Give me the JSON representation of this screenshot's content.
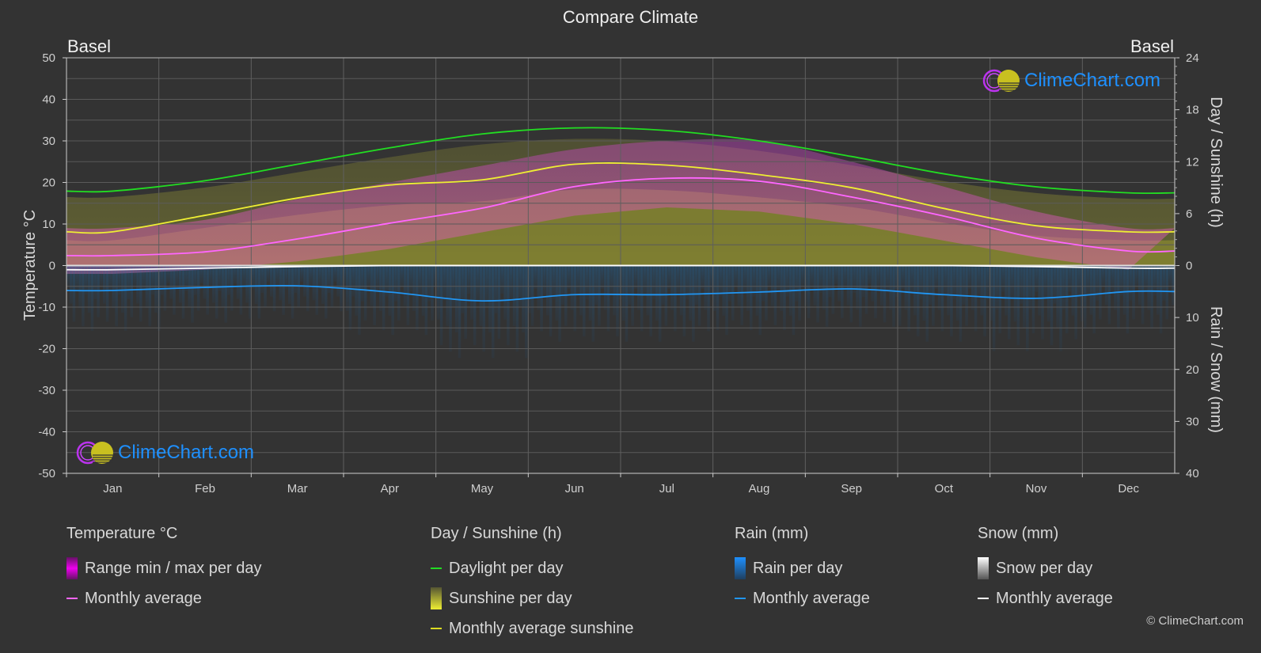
{
  "chart_data": {
    "type": "area",
    "title": "Compare Climate",
    "location_left": "Basel",
    "location_right": "Basel",
    "categories": [
      "Jan",
      "Feb",
      "Mar",
      "Apr",
      "May",
      "Jun",
      "Jul",
      "Aug",
      "Sep",
      "Oct",
      "Nov",
      "Dec"
    ],
    "axes": {
      "left": {
        "label": "Temperature °C",
        "ylim": [
          -50,
          50
        ],
        "ticks": [
          50,
          40,
          30,
          20,
          10,
          0,
          -10,
          -20,
          -30,
          -40,
          -50
        ]
      },
      "right_top": {
        "label": "Day / Sunshine (h)",
        "ylim": [
          0,
          24
        ],
        "ticks": [
          24,
          18,
          12,
          6,
          0
        ]
      },
      "right_bottom": {
        "label": "Rain / Snow (mm)",
        "ylim": [
          0,
          40
        ],
        "ticks": [
          0,
          10,
          20,
          30,
          40
        ],
        "inverted": true
      }
    },
    "grid": true,
    "series": [
      {
        "name": "Temperature monthly average",
        "unit": "°C",
        "color": "#ff66ff",
        "values": [
          2.4,
          3.3,
          6.4,
          10.2,
          13.8,
          19.0,
          21.0,
          20.3,
          16.5,
          11.9,
          6.6,
          3.5
        ]
      },
      {
        "name": "Daylight per day",
        "unit": "h",
        "color": "#22dd22",
        "values": [
          8.6,
          9.8,
          11.7,
          13.6,
          15.2,
          15.9,
          15.6,
          14.4,
          12.6,
          10.6,
          9.1,
          8.4
        ]
      },
      {
        "name": "Monthly average sunshine",
        "unit": "h",
        "color": "#eeee33",
        "values": [
          3.9,
          5.8,
          7.8,
          9.3,
          9.9,
          11.7,
          11.6,
          10.5,
          9.0,
          6.6,
          4.6,
          3.9
        ]
      },
      {
        "name": "Rain monthly average",
        "unit": "mm",
        "color": "#2196f3",
        "values": [
          4.8,
          4.2,
          3.9,
          5.1,
          6.8,
          5.6,
          5.6,
          5.1,
          4.5,
          5.6,
          6.3,
          5.0
        ]
      },
      {
        "name": "Snow monthly average",
        "unit": "mm",
        "color": "#ffffff",
        "values": [
          0.8,
          0.5,
          0.2,
          0,
          0,
          0,
          0,
          0,
          0,
          0,
          0.2,
          0.5
        ]
      }
    ],
    "temperature_range_approx": {
      "max": [
        5,
        7,
        12,
        16,
        20,
        24,
        26,
        26,
        21,
        15,
        9,
        5
      ],
      "min": [
        -2,
        -1,
        1,
        4,
        8,
        12,
        14,
        13,
        10,
        6,
        2,
        -1
      ]
    }
  },
  "legend": {
    "temperature": {
      "header": "Temperature °C",
      "items": [
        "Range min / max per day",
        "Monthly average"
      ]
    },
    "sunshine": {
      "header": "Day / Sunshine (h)",
      "items": [
        "Daylight per day",
        "Sunshine per day",
        "Monthly average sunshine"
      ]
    },
    "rain": {
      "header": "Rain (mm)",
      "items": [
        "Rain per day",
        "Monthly average"
      ]
    },
    "snow": {
      "header": "Snow (mm)",
      "items": [
        "Snow per day",
        "Monthly average"
      ]
    }
  },
  "branding": {
    "logo_text": "ClimeChart.com",
    "copyright": "© ClimeChart.com"
  }
}
